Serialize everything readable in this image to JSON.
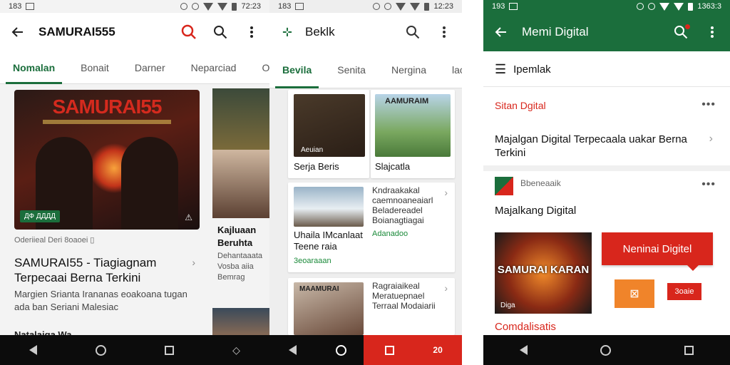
{
  "phone1": {
    "status": {
      "time": "183",
      "clock": "72:23"
    },
    "appbar": {
      "title": "SAMURAI555"
    },
    "tabs": [
      "Nomalan",
      "Bonait",
      "Darner",
      "Neparciad",
      "Oeraiat"
    ],
    "hero": {
      "logo": "SAMURAI55",
      "badge": "ДФ ДДДД"
    },
    "meta": "Oderiieal Deri 8oaoei ▯",
    "title": "SAMURAI55 - Tiagiagnam Terpecaai Berna Terkini",
    "desc": "Margien Srianta Irananas eoakoana tugan ada ban Seriani Malesiac",
    "bottom": "Natalaiga Wa",
    "side": {
      "title": "Kajluaan Beruhta",
      "desc": "Dehantaaata Vosba aiia Bemrag"
    }
  },
  "phone2": {
    "status": {
      "time": "183",
      "clock": "12:23"
    },
    "appbar": {
      "title": "Beklk"
    },
    "tabs": [
      "Bevila",
      "Senita",
      "Nergina",
      "laote"
    ],
    "grid": [
      {
        "label": "Serja Beris",
        "thumb_text": "Aeuian"
      },
      {
        "label": "Slajcatla",
        "thumb_text": "AAMURAIM"
      }
    ],
    "list": [
      {
        "title": "Uhaila IMcanlaat Teene raia",
        "text": "Kndraakakal caemnoaneaiarl Beladereadel Boianagtiagai",
        "tag": "Adanadoo",
        "tag2": "3eoaraaan"
      },
      {
        "title": "",
        "text": "Ragraiaikeal Meratuepnael Terraal Modaiarii",
        "tag": "",
        "tag2": "",
        "thumb_text": "MAAMURAI"
      }
    ],
    "nav_label": "20"
  },
  "phone3": {
    "status": {
      "time": "193",
      "clock": "1363:3"
    },
    "appbar": {
      "title": "Memi Digital"
    },
    "menu": "Ipemlak",
    "section1": "Sitan Dgital",
    "item1": "Majalgan Digital Terpecaala uakar Berna Terkini",
    "source": "Bbeneaaik",
    "item2": "Majalkang Digital",
    "image": {
      "title": "SAMURAI KARAN",
      "label": "Diga"
    },
    "banner": "Neninai Digitel",
    "orange_icon": "⊠",
    "red_label": "3oaie",
    "footer": "Comdalisatis"
  }
}
